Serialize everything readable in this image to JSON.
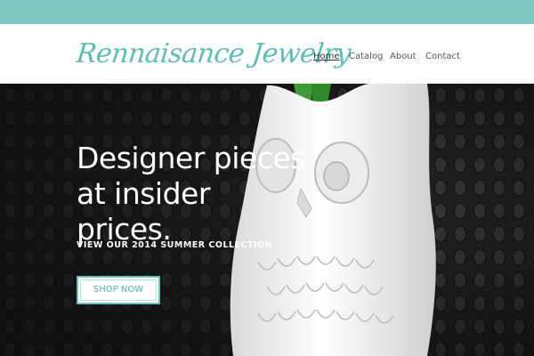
{
  "brand": {
    "logo_text": "Rennaisance Jewelry",
    "accent_color": "#7ec7c1"
  },
  "nav": {
    "items": [
      {
        "label": "Home",
        "active": true
      },
      {
        "label": "Catalog",
        "active": false
      },
      {
        "label": "About",
        "active": false
      },
      {
        "label": "Contact",
        "active": false
      }
    ]
  },
  "hero": {
    "headline_line1": "Designer pieces",
    "headline_line2": "at insider prices.",
    "subhead": "VIEW OUR 2014 SUMMER COLLECTION",
    "cta_label": "SHOP NOW",
    "image_subject": "white ceramic owl vase"
  }
}
